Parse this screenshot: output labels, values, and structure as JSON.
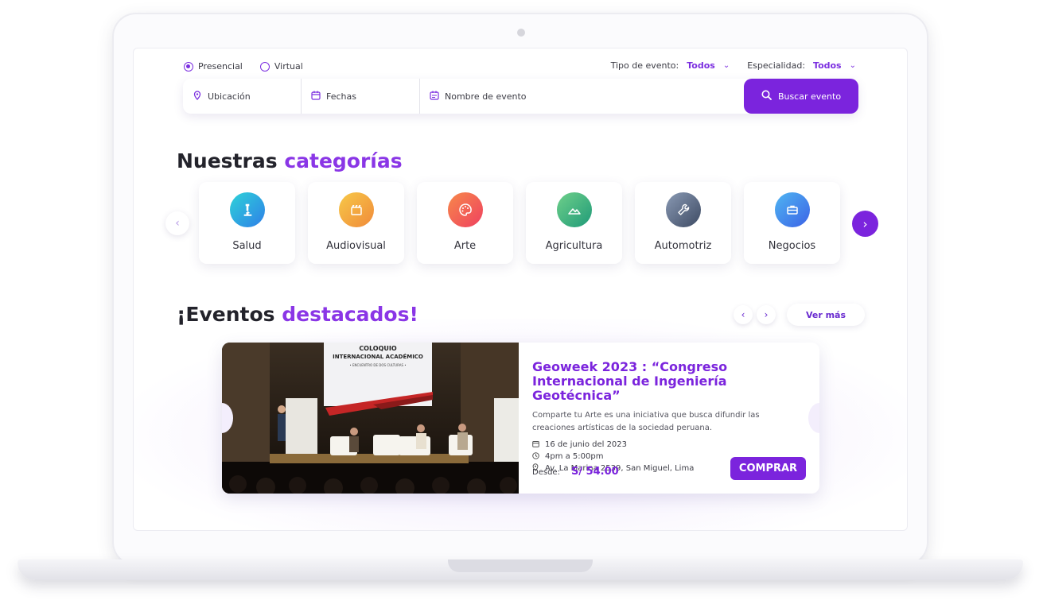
{
  "filters": {
    "modes": [
      {
        "label": "Presencial",
        "selected": true
      },
      {
        "label": "Virtual",
        "selected": false
      }
    ],
    "event_type": {
      "label": "Tipo de evento:",
      "value": "Todos"
    },
    "specialty": {
      "label": "Especialidad:",
      "value": "Todos"
    }
  },
  "search": {
    "location": "Ubicación",
    "dates": "Fechas",
    "event_name": "Nombre de evento",
    "button": "Buscar evento"
  },
  "categories": {
    "title_main": "Nuestras",
    "title_accent": "categorías",
    "items": [
      {
        "label": "Salud",
        "icon": "microscope-icon",
        "color": "#2ea8e8"
      },
      {
        "label": "Audiovisual",
        "icon": "clapperboard-icon",
        "color": "#f2a23a"
      },
      {
        "label": "Arte",
        "icon": "palette-icon",
        "color": "#f05a4a"
      },
      {
        "label": "Agricultura",
        "icon": "landscape-icon",
        "color": "#2fa978"
      },
      {
        "label": "Automotriz",
        "icon": "wrench-icon",
        "color": "#5b6b86"
      },
      {
        "label": "Negocios",
        "icon": "briefcase-icon",
        "color": "#3a7ee6"
      }
    ]
  },
  "events": {
    "title_main": "¡Eventos",
    "title_accent": "destacados!",
    "see_more": "Ver más",
    "featured": {
      "name_line1": "Geoweek 2023 : “Congreso",
      "name_line2": "Internacional de Ingeniería Geotécnica”",
      "description": "Comparte tu Arte es una iniciativa que busca difundir las creaciones artísticas de la sociedad peruana.",
      "date": "16 de junio del 2023",
      "time": "4pm a 5:00pm",
      "address": "Av. La Marina 2539, San Miguel, Lima",
      "price_label": "Desde:",
      "price": "S/ 54.00",
      "buy": "COMPRAR",
      "image_banner_line1": "COLOQUIO",
      "image_banner_line2": "INTERNACIONAL ACADÉMICO",
      "image_banner_line3": "• ENCUENTRO DE DOS CULTURAS •"
    }
  },
  "colors": {
    "accent": "#7b24dd",
    "accent_text": "#8a36e6"
  }
}
